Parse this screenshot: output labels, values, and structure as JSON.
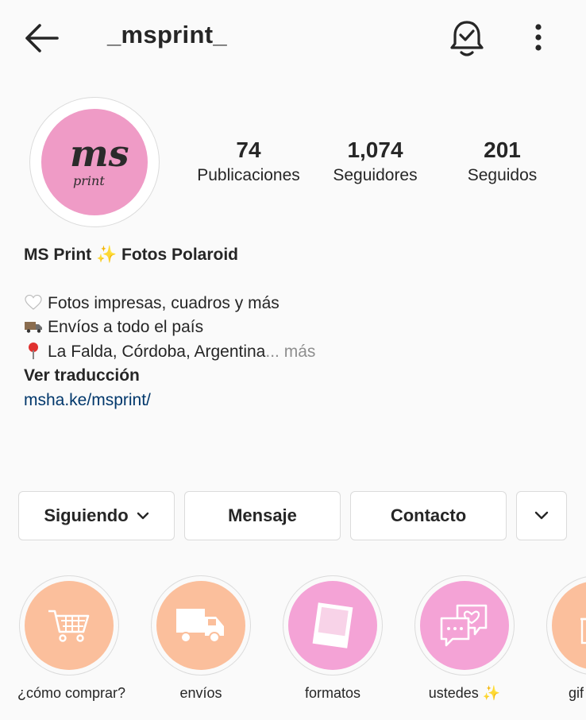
{
  "header": {
    "username": "_msprint_",
    "icons": [
      "back-arrow-icon",
      "notification-bell-icon",
      "more-vertical-icon"
    ]
  },
  "profile": {
    "avatar_text_top": "ms",
    "avatar_text_bottom": "print",
    "avatar_color": "#ef9bc6"
  },
  "stats": [
    {
      "value": "74",
      "label": "Publicaciones"
    },
    {
      "value": "1,074",
      "label": "Seguidores"
    },
    {
      "value": "201",
      "label": "Seguidos"
    }
  ],
  "bio": {
    "name_part1": "MS Print ",
    "name_emoji": "✨",
    "name_part2": " Fotos Polaroid",
    "line1": "Fotos impresas, cuadros y más",
    "line2": "Envíos a todo el país",
    "line3": "La Falda, Córdoba, Argentina",
    "more": "... más",
    "translate": "Ver traducción",
    "link": "msha.ke/msprint/",
    "line_icons": [
      "white-heart-icon",
      "truck-icon",
      "pin-icon"
    ]
  },
  "buttons": {
    "following": "Siguiendo",
    "message": "Mensaje",
    "contact": "Contacto"
  },
  "highlights": [
    {
      "label": "¿cómo comprar?",
      "icon": "cart-icon",
      "color": "#fbbf9c"
    },
    {
      "label": "envíos",
      "icon": "truck-icon",
      "color": "#fbbf9c"
    },
    {
      "label": "formatos",
      "icon": "polaroid-icon",
      "color": "#f4a3d6"
    },
    {
      "label": "ustedes",
      "emoji": "✨",
      "icon": "chat-heart-icon",
      "color": "#f4a3d6"
    },
    {
      "label": "gif",
      "icon": "gift-icon",
      "color": "#fbbf9c"
    }
  ]
}
